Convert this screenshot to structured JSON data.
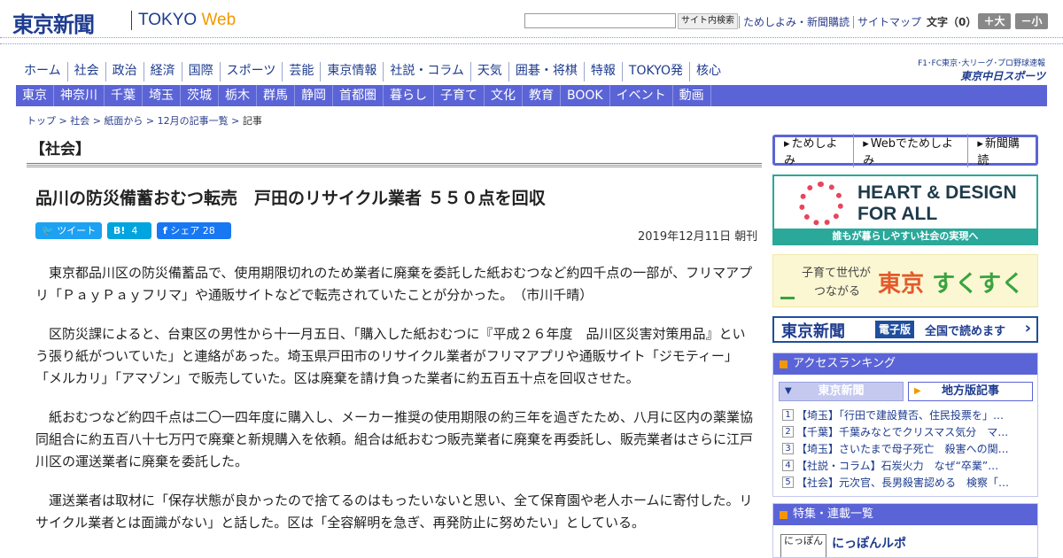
{
  "header": {
    "logo": "東京新聞",
    "logo_sub_a": "TOKYO ",
    "logo_sub_b": "Web",
    "search_placeholder": "",
    "search_button": "サイト内検索",
    "links": [
      "ためしよみ・新聞購読",
      "サイトマップ"
    ],
    "font_size_label": "文字（0）",
    "font_plus": "＋大",
    "font_minus": "－小"
  },
  "nav_main": [
    "ホーム",
    "社会",
    "政治",
    "経済",
    "国際",
    "スポーツ",
    "芸能",
    "東京情報",
    "社説・コラム",
    "天気",
    "囲碁・将棋",
    "特報",
    "TOKYO発",
    "核心"
  ],
  "chunichi": {
    "line1": "F1･FC東京･大リーグ･プロ野球速報",
    "line2": "東京中日スポーツ"
  },
  "nav_area": [
    "東京",
    "神奈川",
    "千葉",
    "埼玉",
    "茨城",
    "栃木",
    "群馬",
    "静岡",
    "首都圏",
    "暮らし",
    "子育て",
    "文化",
    "教育",
    "BOOK",
    "イベント",
    "動画"
  ],
  "breadcrumb": {
    "items": [
      "トップ",
      "社会",
      "紙面から",
      "12月の記事一覧"
    ],
    "current": "記事",
    "sep": " > "
  },
  "article": {
    "section": "【社会】",
    "title": "品川の防災備蓄おむつ転売　戸田のリサイクル業者 ５５０点を回収",
    "share": {
      "tweet": "ツイート",
      "hatena": "4",
      "fb_label": "シェア",
      "fb_count": "28"
    },
    "date": "2019年12月11日 朝刊",
    "paragraphs": [
      "東京都品川区の防災備蓄品で、使用期限切れのため業者に廃棄を委託した紙おむつなど約四千点の一部が、フリマアプリ「ＰａｙＰａｙフリマ」や通販サイトなどで転売されていたことが分かった。　（市川千晴）",
      "区防災課によると、台東区の男性から十一月五日、「購入した紙おむつに『平成２６年度　品川区災害対策用品』という張り紙がついていた」と連絡があった。埼玉県戸田市のリサイクル業者がフリマアプリや通販サイト「ジモティー」「メルカリ」「アマゾン」で販売していた。区は廃棄を請け負った業者に約五百五十点を回収させた。",
      "紙おむつなど約四千点は二〇一四年度に購入し、メーカー推奨の使用期限の約三年を過ぎたため、八月に区内の薬業協同組合に約五百八十七万円で廃棄と新規購入を依頼。組合は紙おむつ販売業者に廃棄を再委託し、販売業者はさらに江戸川区の運送業者に廃棄を委託した。",
      "運送業者は取材に「保存状態が良かったので捨てるのはもったいないと思い、全て保育園や老人ホームに寄付した。リサイクル業者とは面識がない」と話した。区は「全容解明を急ぎ、再発防止に努めたい」としている。"
    ]
  },
  "sidebar": {
    "promo_links": [
      "ためしよみ",
      "Webでためしよみ",
      "新聞購読"
    ],
    "heart": {
      "title1": "HEART & DESIGN",
      "title2": "FOR ALL",
      "foot": "誰もが暮らしやすい社会の実現へ"
    },
    "sukusuku": {
      "l1": "子育て世代が",
      "l2": "つながる",
      "big1": "東京",
      "big2": "すくすく"
    },
    "eban": {
      "n1": "東京新聞",
      "n2": "電子版",
      "n3": "全国で読めます"
    },
    "ranking": {
      "title": "アクセスランキング",
      "tab_a": "東京新聞",
      "tab_b": "地方版記事",
      "items": [
        {
          "num": "1",
          "text": "【埼玉】「行田で建設賛否、住民投票を」…"
        },
        {
          "num": "2",
          "text": "【千葉】千葉みなとでクリスマス気分　マ…"
        },
        {
          "num": "3",
          "text": "【埼玉】さいたまで母子死亡　殺害への関…"
        },
        {
          "num": "4",
          "text": "【社説・コラム】石炭火力　なぜ“卒業”…"
        },
        {
          "num": "5",
          "text": "【社会】元次官、長男殺害認める　検察「…"
        }
      ]
    },
    "feature": {
      "title": "特集・連載一覧",
      "thumb": "にっぽん",
      "item": "にっぽんルポ"
    }
  },
  "colors": {
    "brand_navy": "#1e3c8f",
    "nav_purple": "#5b64d6",
    "accent_orange": "#f39800"
  }
}
